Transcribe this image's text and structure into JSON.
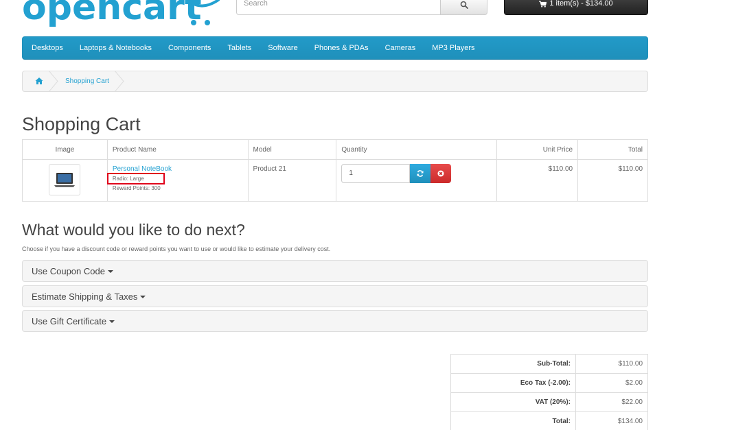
{
  "header": {
    "logo_text": "opencart",
    "search_placeholder": "Search",
    "cart_label": "1 item(s) - $134.00"
  },
  "menu": [
    "Desktops",
    "Laptops & Notebooks",
    "Components",
    "Tablets",
    "Software",
    "Phones & PDAs",
    "Cameras",
    "MP3 Players"
  ],
  "breadcrumb": {
    "current": "Shopping Cart"
  },
  "page_title": "Shopping Cart",
  "cart": {
    "headers": {
      "image": "Image",
      "product_name": "Product Name",
      "model": "Model",
      "quantity": "Quantity",
      "unit_price": "Unit Price",
      "total": "Total"
    },
    "items": [
      {
        "name": "Personal NoteBook",
        "option": "Radio: Large",
        "reward": "Reward Points: 300",
        "model": "Product 21",
        "quantity": "1",
        "unit_price": "$110.00",
        "total": "$110.00"
      }
    ]
  },
  "next": {
    "title": "What would you like to do next?",
    "description": "Choose if you have a discount code or reward points you want to use or would like to estimate your delivery cost.",
    "panels": [
      "Use Coupon Code",
      "Estimate Shipping & Taxes",
      "Use Gift Certificate"
    ]
  },
  "totals": [
    {
      "label": "Sub-Total:",
      "value": "$110.00"
    },
    {
      "label": "Eco Tax (-2.00):",
      "value": "$2.00"
    },
    {
      "label": "VAT (20%):",
      "value": "$22.00"
    },
    {
      "label": "Total:",
      "value": "$134.00"
    }
  ],
  "colors": {
    "brand": "#23a1d1",
    "menu": "#229ac8",
    "danger": "#da4f49",
    "highlight": "#e0001a"
  },
  "icons": {
    "search": "search-icon",
    "cart": "shopping-cart-icon",
    "home": "home-icon",
    "update": "refresh-icon",
    "remove": "times-circle-icon"
  }
}
